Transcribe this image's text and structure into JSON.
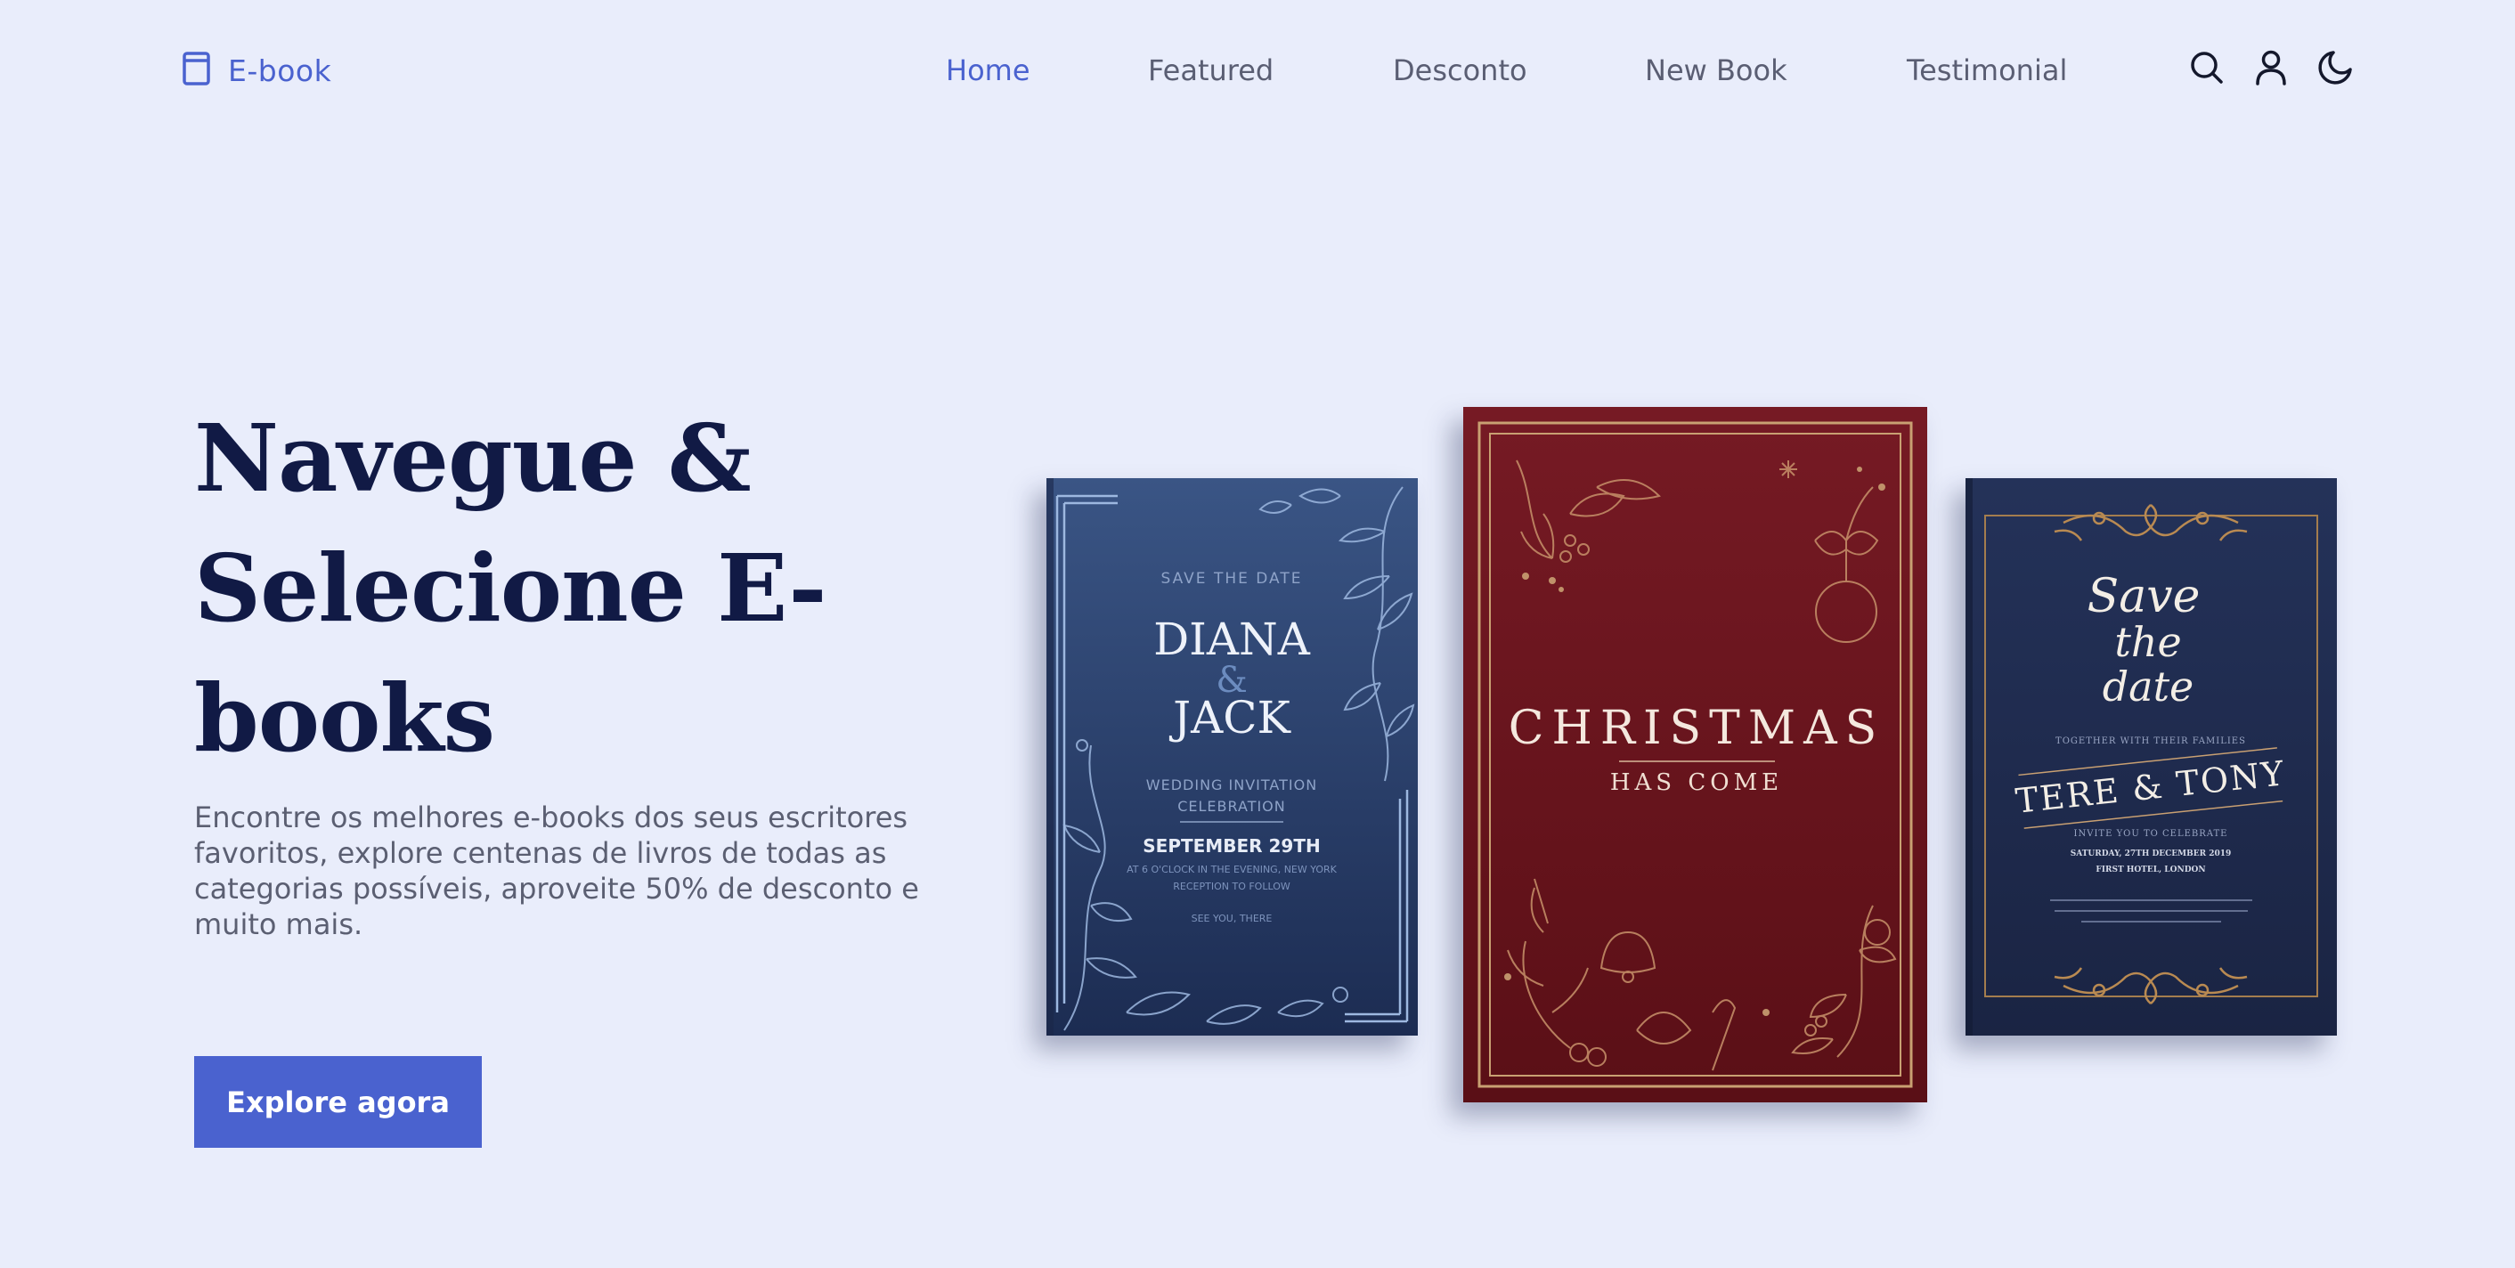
{
  "header": {
    "logo_text": "E-book",
    "nav": [
      {
        "label": "Home",
        "active": true
      },
      {
        "label": "Featured",
        "active": false
      },
      {
        "label": "Desconto",
        "active": false
      },
      {
        "label": "New Book",
        "active": false
      },
      {
        "label": "Testimonial",
        "active": false
      }
    ],
    "icons": [
      "search-icon",
      "user-icon",
      "moon-icon"
    ]
  },
  "hero": {
    "title_line1": "Navegue &",
    "title_line2": "Selecione E-",
    "title_line3": "books",
    "description": "Encontre os melhores e-books dos seus escritores favoritos, explore centenas de livros de todas as categorias possíveis, aproveite 50% de desconto e muito mais.",
    "cta_label": "Explore agora"
  },
  "books": {
    "left": {
      "save_the_date": "SAVE THE DATE",
      "name1": "DIANA",
      "amp": "&",
      "name2": "JACK",
      "sub1": "WEDDING INVITATION",
      "sub2": "CELEBRATION",
      "date": "SEPTEMBER 29TH",
      "detail1": "AT 6 O'CLOCK IN THE EVENING, NEW YORK",
      "detail2": "RECEPTION TO FOLLOW",
      "detail3": "SEE YOU, THERE"
    },
    "center": {
      "title": "CHRISTMAS",
      "subtitle": "HAS COME"
    },
    "right": {
      "script1": "Save",
      "script2": "the",
      "script3": "date",
      "together": "TOGETHER WITH THEIR FAMILIES",
      "names": "TERE & TONY",
      "invite": "INVITE YOU TO CELEBRATE",
      "date_line": "SATURDAY, 27TH DECEMBER 2019",
      "venue": "FIRST HOTEL, LONDON"
    }
  },
  "colors": {
    "accent": "#4a62cf",
    "background": "#e9edfb",
    "title": "#111a45",
    "book_left": "#2d4470",
    "book_center": "#6b131b",
    "book_right": "#1f2b4d",
    "gold": "#c9a072"
  }
}
